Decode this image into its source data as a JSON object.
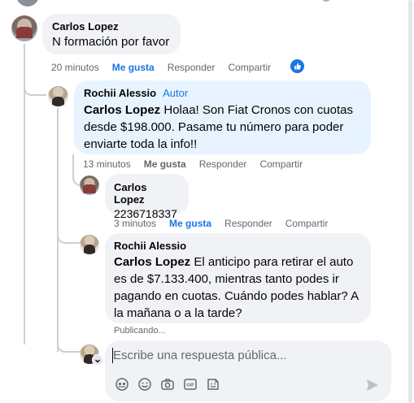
{
  "comment1": {
    "author": "Carlos Lopez",
    "text": "N formación por favor",
    "time": "20 minutos",
    "like": "Me gusta",
    "reply": "Responder",
    "share": "Compartir"
  },
  "reply1": {
    "author": "Rochii Alessio",
    "badge": "Autor",
    "mention": "Carlos Lopez",
    "text_line1": " Holaa! Son Fiat Cronos con cuotas",
    "text_line2": "desde $198.000. Pasame tu número para poder",
    "text_line3": "enviarte toda la info!!",
    "time": "13 minutos",
    "like": "Me gusta",
    "reply": "Responder",
    "share": "Compartir"
  },
  "reply2": {
    "author": "Carlos Lopez",
    "text": "2236718337",
    "time": "3 minutos",
    "like": "Me gusta",
    "reply": "Responder",
    "share": "Compartir"
  },
  "reply3": {
    "author": "Rochii Alessio",
    "mention": "Carlos Lopez",
    "text_line1": " El anticipo para retirar el auto",
    "text_line2": "es de $7.133.400, mientras tanto podes ir",
    "text_line3": "pagando en cuotas. Cuándo podes hablar? A",
    "text_line4": "la mañana o a la tarde?",
    "status": "Publicando..."
  },
  "reply_box": {
    "placeholder": "Escribe una respuesta pública..."
  },
  "colors": {
    "like_blue": "#1b74e4",
    "bubble_gray": "#f0f2f5",
    "bubble_highlight": "#e7f3ff"
  },
  "icons": [
    "like-reaction-icon",
    "avatar-icon",
    "sticker-icon",
    "emoji-icon",
    "camera-icon",
    "gif-icon",
    "sticker-face-icon",
    "send-icon"
  ]
}
